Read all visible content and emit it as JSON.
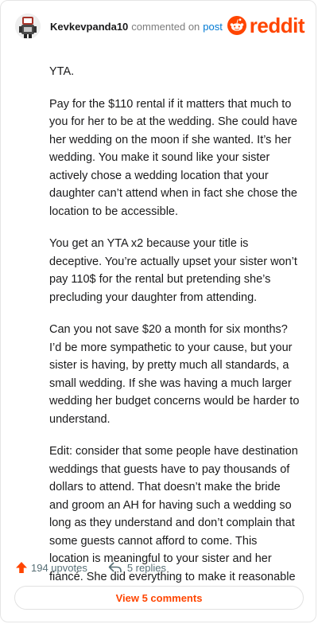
{
  "header": {
    "username": "Kevkevpanda10",
    "commented_text": "commented on",
    "post_link": "post",
    "brand": "reddit"
  },
  "comment": {
    "paragraphs": [
      "YTA.",
      "Pay for the $110 rental if it matters that much to you for her to be at the wedding. She could have her wedding on the moon if she wanted. It’s her wedding. You make it sound like your sister actively chose a wedding location that your daughter can’t attend when in fact she chose the location to be accessible.",
      "You get an YTA x2 because your title is deceptive. You’re actually upset your sister won’t pay 110$ for the rental but pretending she’s precluding your daughter from attending.",
      "Can you not save $20 a month for six months? I’d be more sympathetic to your cause, but your sister is having, by pretty much all standards, a small wedding. If she was having a much larger wedding her budget concerns would be harder to understand.",
      "Edit: consider that some people have destination weddings that guests have to pay thousands of dollars to attend. That doesn’t make the bride and groom an AH for having such a wedding so long as they understand and don’t complain that some guests cannot afford to come. This location is meaningful to your sister and her fiancé. She did everything to make it reasonable"
    ]
  },
  "actions": {
    "upvotes": "194 upvotes",
    "replies": "5 replies"
  },
  "footer": {
    "view_comments": "View 5 comments"
  },
  "colors": {
    "brand": "#ff4500",
    "link": "#0079d3",
    "muted": "#576f76"
  },
  "icons": {
    "upvote": "upvote-arrow-icon",
    "reply": "reply-arrow-icon",
    "logo": "reddit-snoo-icon",
    "avatar": "user-avatar"
  }
}
